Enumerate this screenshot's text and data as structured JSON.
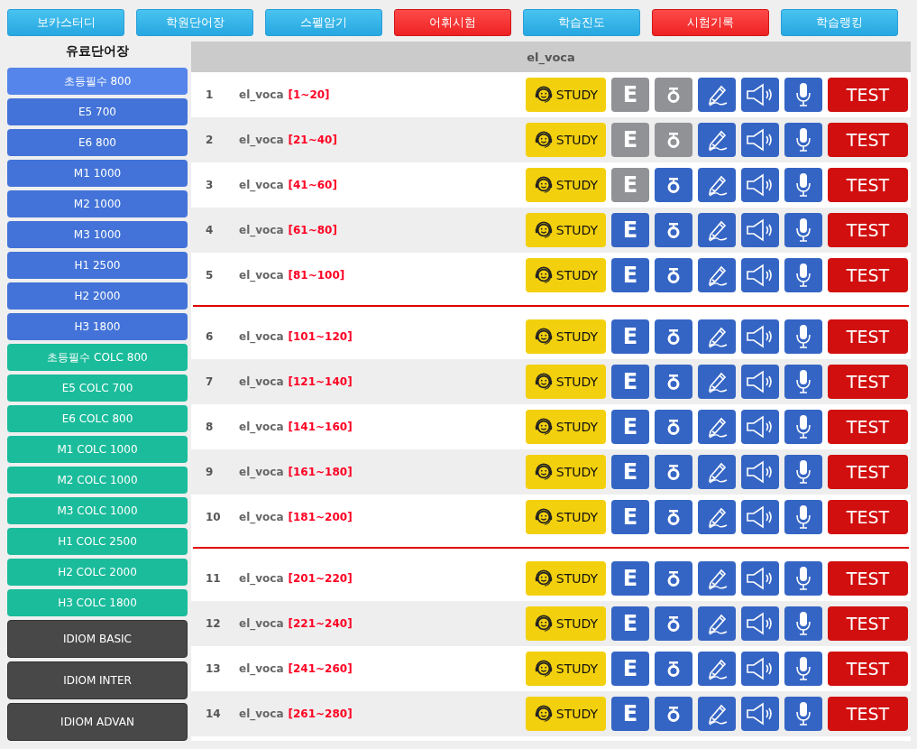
{
  "nav": [
    {
      "label": "보카스터디",
      "active": false
    },
    {
      "label": "학원단어장",
      "active": false
    },
    {
      "label": "스펠암기",
      "active": false
    },
    {
      "label": "어휘시험",
      "active": true
    },
    {
      "label": "학습진도",
      "active": false
    },
    {
      "label": "시험기록",
      "active": true
    },
    {
      "label": "학습랭킹",
      "active": false
    }
  ],
  "sidebar": {
    "title": "유료단어장",
    "items": [
      {
        "label": "초등필수 800",
        "kind": "basic",
        "selected": true
      },
      {
        "label": "E5 700",
        "kind": "basic",
        "selected": false
      },
      {
        "label": "E6 800",
        "kind": "basic",
        "selected": false
      },
      {
        "label": "M1 1000",
        "kind": "basic",
        "selected": false
      },
      {
        "label": "M2 1000",
        "kind": "basic",
        "selected": false
      },
      {
        "label": "M3 1000",
        "kind": "basic",
        "selected": false
      },
      {
        "label": "H1 2500",
        "kind": "basic",
        "selected": false
      },
      {
        "label": "H2 2000",
        "kind": "basic",
        "selected": false
      },
      {
        "label": "H3 1800",
        "kind": "basic",
        "selected": false
      },
      {
        "label": "초등필수 COLC 800",
        "kind": "colc",
        "selected": false
      },
      {
        "label": "E5 COLC 700",
        "kind": "colc",
        "selected": false
      },
      {
        "label": "E6 COLC 800",
        "kind": "colc",
        "selected": false
      },
      {
        "label": "M1 COLC 1000",
        "kind": "colc",
        "selected": false
      },
      {
        "label": "M2 COLC 1000",
        "kind": "colc",
        "selected": false
      },
      {
        "label": "M3 COLC 1000",
        "kind": "colc",
        "selected": false
      },
      {
        "label": "H1 COLC 2500",
        "kind": "colc",
        "selected": false
      },
      {
        "label": "H2 COLC 2000",
        "kind": "colc",
        "selected": false
      },
      {
        "label": "H3 COLC 1800",
        "kind": "colc",
        "selected": false
      },
      {
        "label": "IDIOM BASIC",
        "kind": "idiom",
        "selected": false
      },
      {
        "label": "IDIOM INTER",
        "kind": "idiom",
        "selected": false
      },
      {
        "label": "IDIOM ADVAN",
        "kind": "idiom",
        "selected": false
      }
    ]
  },
  "table": {
    "title": "el_voca",
    "sections": [
      {
        "rows": [
          {
            "number": "1",
            "name": "el_voca",
            "range": "[1~20]",
            "study": "STUDY",
            "e": "E",
            "test": "TEST",
            "e_done": true,
            "o_done": true
          },
          {
            "number": "2",
            "name": "el_voca",
            "range": "[21~40]",
            "study": "STUDY",
            "e": "E",
            "test": "TEST",
            "e_done": true,
            "o_done": true
          },
          {
            "number": "3",
            "name": "el_voca",
            "range": "[41~60]",
            "study": "STUDY",
            "e": "E",
            "test": "TEST",
            "e_done": true,
            "o_done": false
          },
          {
            "number": "4",
            "name": "el_voca",
            "range": "[61~80]",
            "study": "STUDY",
            "e": "E",
            "test": "TEST",
            "e_done": false,
            "o_done": false
          },
          {
            "number": "5",
            "name": "el_voca",
            "range": "[81~100]",
            "study": "STUDY",
            "e": "E",
            "test": "TEST",
            "e_done": false,
            "o_done": false
          }
        ]
      },
      {
        "rows": [
          {
            "number": "6",
            "name": "el_voca",
            "range": "[101~120]",
            "study": "STUDY",
            "e": "E",
            "test": "TEST",
            "e_done": false,
            "o_done": false
          },
          {
            "number": "7",
            "name": "el_voca",
            "range": "[121~140]",
            "study": "STUDY",
            "e": "E",
            "test": "TEST",
            "e_done": false,
            "o_done": false
          },
          {
            "number": "8",
            "name": "el_voca",
            "range": "[141~160]",
            "study": "STUDY",
            "e": "E",
            "test": "TEST",
            "e_done": false,
            "o_done": false
          },
          {
            "number": "9",
            "name": "el_voca",
            "range": "[161~180]",
            "study": "STUDY",
            "e": "E",
            "test": "TEST",
            "e_done": false,
            "o_done": false
          },
          {
            "number": "10",
            "name": "el_voca",
            "range": "[181~200]",
            "study": "STUDY",
            "e": "E",
            "test": "TEST",
            "e_done": false,
            "o_done": false
          }
        ]
      },
      {
        "rows": [
          {
            "number": "11",
            "name": "el_voca",
            "range": "[201~220]",
            "study": "STUDY",
            "e": "E",
            "test": "TEST",
            "e_done": false,
            "o_done": false
          },
          {
            "number": "12",
            "name": "el_voca",
            "range": "[221~240]",
            "study": "STUDY",
            "e": "E",
            "test": "TEST",
            "e_done": false,
            "o_done": false
          },
          {
            "number": "13",
            "name": "el_voca",
            "range": "[241~260]",
            "study": "STUDY",
            "e": "E",
            "test": "TEST",
            "e_done": false,
            "o_done": false
          },
          {
            "number": "14",
            "name": "el_voca",
            "range": "[261~280]",
            "study": "STUDY",
            "e": "E",
            "test": "TEST",
            "e_done": false,
            "o_done": false
          }
        ]
      }
    ]
  }
}
